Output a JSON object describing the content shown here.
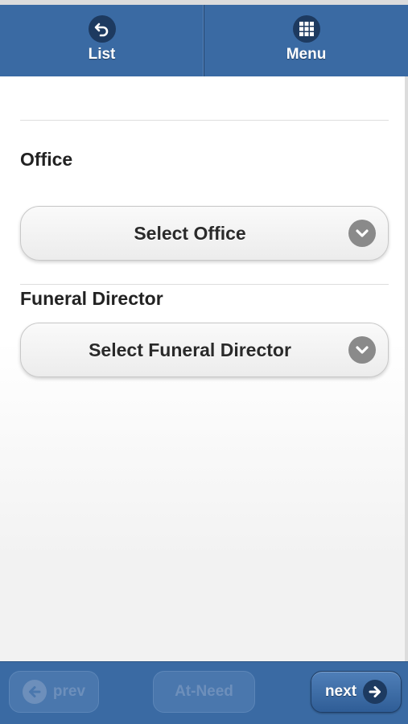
{
  "header": {
    "list_label": "List",
    "menu_label": "Menu",
    "list_icon": "back-arrow-icon",
    "menu_icon": "grid-icon"
  },
  "form": {
    "office_label": "Office",
    "office_select": "Select Office",
    "director_label": "Funeral Director",
    "director_select": "Select Funeral Director"
  },
  "footer": {
    "prev_label": "prev",
    "atneed_label": "At-Need",
    "next_label": "next"
  },
  "colors": {
    "brand_blue": "#3a6aa3",
    "dark_blue": "#1d3a60"
  }
}
